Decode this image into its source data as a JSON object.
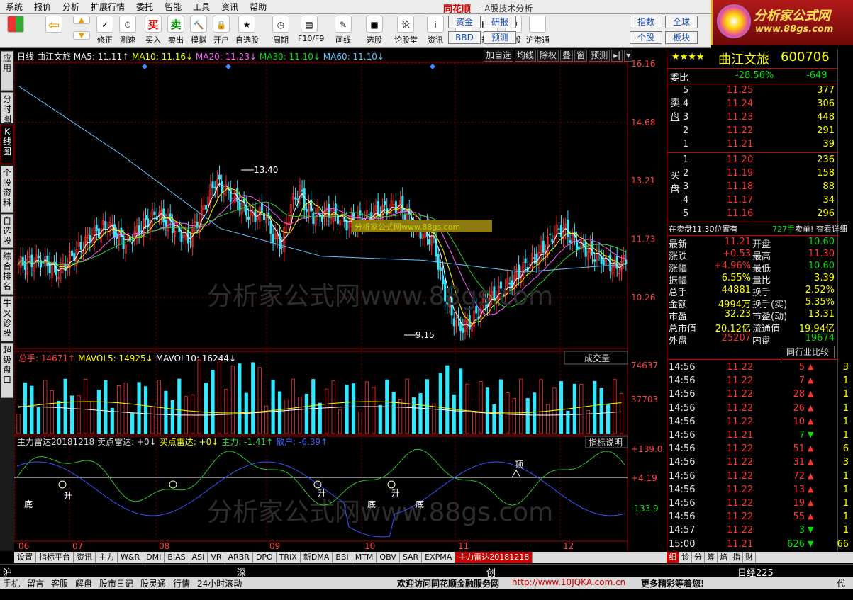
{
  "menu": {
    "items": [
      "系统",
      "报价",
      "分析",
      "扩展行情",
      "委托",
      "智能",
      "工具",
      "资讯",
      "帮助"
    ],
    "brand": "同花顺",
    "subtitle": "- A股技术分析"
  },
  "logo": {
    "title": "分析家公式网",
    "url": "www.88gs.com"
  },
  "toolbar": {
    "buttons": [
      "修正",
      "测速",
      "买入",
      "卖出",
      "模拟",
      "开户",
      "自选股",
      "周期",
      "F10/F9",
      "画线",
      "选股",
      "论股堂",
      "资讯",
      "数据",
      "热点",
      "新股",
      "沪港通"
    ],
    "button_icons": [
      "买",
      "卖"
    ],
    "small_buttons": [
      "资金",
      "研报",
      "BBD",
      "预测",
      "指数",
      "全球",
      "个股",
      "板块"
    ]
  },
  "leftbar": {
    "tabs": [
      "应用",
      "分时图",
      "K线图",
      "个股资料",
      "自选股",
      "综合排名",
      "牛叉诊股",
      "超级盘口"
    ]
  },
  "chart": {
    "period": "日线",
    "stock_name": "曲江文旅",
    "ma5": "MA5: 11.11↑",
    "ma10": "MA10: 11.16↓",
    "ma20": "MA20: 11.23↓",
    "ma30": "MA30: 11.10↓",
    "ma60": "MA60: 11.10↓",
    "buttons": [
      "加自选",
      "均线",
      "除权",
      "叠",
      "窗",
      "预测"
    ],
    "price_ticks": [
      "16.16",
      "14.68",
      "13.21",
      "11.73",
      "10.26"
    ],
    "high_label": "13.40",
    "low_label": "9.15",
    "watermark": "分析家公式网www.88gs.com",
    "ad_label": "分析家公式网www.88gs.com",
    "vol_header": {
      "total": "总手: 14671↑",
      "mavol5": "MAVOL5: 14925↓",
      "mavol10": "MAVOL10: 16244↓"
    },
    "vol_select": "成交量",
    "vol_ticks": [
      "74637",
      "37703"
    ],
    "ind_header": {
      "name": "主力雷达20181218",
      "sell": "卖点雷达: +0↓",
      "buy": "买点雷达: +0↓",
      "main": "主力: -1.41↑",
      "retail": "散户: -6.39↑"
    },
    "ind_button": "指标说明",
    "ind_ticks": [
      "+139.0",
      "+4.19",
      "-133.9"
    ],
    "ind_marks": [
      "底",
      "升",
      "升",
      "底",
      "升",
      "底",
      "顶"
    ],
    "months": [
      "06",
      "07",
      "08",
      "09",
      "10",
      "11",
      "12"
    ]
  },
  "chart_data": {
    "type": "line",
    "title": "曲江文旅 日线",
    "x": [
      "06",
      "07",
      "08",
      "09",
      "10",
      "11",
      "12"
    ],
    "series": [
      {
        "name": "MA60",
        "values": [
          15.6,
          13.9,
          12.0,
          11.3,
          11.2,
          10.9,
          11.1
        ]
      }
    ],
    "close_samples": [
      11.0,
      11.3,
      11.9,
      13.2,
      12.3,
      9.5,
      10.6,
      11.8,
      11.21
    ],
    "ylim": [
      9.15,
      16.16
    ],
    "annotations": [
      "13.40",
      "9.15"
    ]
  },
  "bottom_tabs": [
    "设置",
    "指标平台",
    "资讯",
    "主力",
    "W&R",
    "DMI",
    "BIAS",
    "ASI",
    "VR",
    "ARBR",
    "DPO",
    "TRIX",
    "新DMA",
    "BBI",
    "MTM",
    "OBV",
    "SAR",
    "EXPMA",
    "主力雷达20181218"
  ],
  "right_tabs": [
    "细",
    "诊",
    "分",
    "筹",
    "焰",
    "指",
    "财"
  ],
  "quote": {
    "stars": "★★★★",
    "name": "曲江文旅",
    "code": "600706",
    "weibi_label": "委比",
    "weibi_pct": "-28.56%",
    "weibi_val": "-649",
    "sell_label": "卖盘",
    "buy_label": "买盘",
    "sells": [
      {
        "lvl": "5",
        "price": "11.25",
        "vol": "377"
      },
      {
        "lvl": "4",
        "price": "11.24",
        "vol": "306"
      },
      {
        "lvl": "3",
        "price": "11.23",
        "vol": "448"
      },
      {
        "lvl": "2",
        "price": "11.22",
        "vol": "291"
      },
      {
        "lvl": "1",
        "price": "11.21",
        "vol": "39"
      }
    ],
    "buys": [
      {
        "lvl": "1",
        "price": "11.20",
        "vol": "236"
      },
      {
        "lvl": "2",
        "price": "11.19",
        "vol": "158"
      },
      {
        "lvl": "3",
        "price": "11.18",
        "vol": "88"
      },
      {
        "lvl": "4",
        "price": "11.17",
        "vol": "34"
      },
      {
        "lvl": "5",
        "price": "11.16",
        "vol": "296"
      }
    ],
    "notice_a": "在卖盘11.30位置有",
    "notice_b": "727手",
    "notice_c": "卖单! 查看详细",
    "stats": [
      {
        "k1": "最新",
        "v1": "11.21",
        "k2": "开盘",
        "v2": "10.60"
      },
      {
        "k1": "涨跌",
        "v1": "+0.53",
        "k2": "最高",
        "v2": "11.30"
      },
      {
        "k1": "涨幅",
        "v1": "+4.96%",
        "k2": "最低",
        "v2": "10.60"
      },
      {
        "k1": "振幅",
        "v1": "6.55%",
        "k2": "量比",
        "v2": "3.39"
      },
      {
        "k1": "总手",
        "v1": "44881",
        "k2": "换手",
        "v2": "2.52%"
      },
      {
        "k1": "金额",
        "v1": "4994万",
        "k2": "换手(实)",
        "v2": "5.35%"
      },
      {
        "k1": "市盈",
        "v1": "32.23",
        "k2": "市盈(动)",
        "v2": "13.31"
      },
      {
        "k1": "总市值",
        "v1": "20.12亿",
        "k2": "流通值",
        "v2": "19.94亿"
      },
      {
        "k1": "外盘",
        "v1": "25207",
        "k2": "内盘",
        "v2": "19674"
      }
    ],
    "peer_button": "同行业比较",
    "ticks": [
      {
        "t": "14:56",
        "p": "11.22",
        "v": "5",
        "d": "up"
      },
      {
        "t": "14:56",
        "p": "11.22",
        "v": "7",
        "d": "up"
      },
      {
        "t": "14:56",
        "p": "11.22",
        "v": "28",
        "d": "up"
      },
      {
        "t": "14:56",
        "p": "11.22",
        "v": "26",
        "d": "up"
      },
      {
        "t": "14:56",
        "p": "11.22",
        "v": "10",
        "d": "up"
      },
      {
        "t": "14:56",
        "p": "11.21",
        "v": "7",
        "d": "down"
      },
      {
        "t": "14:56",
        "p": "11.22",
        "v": "51",
        "d": "up"
      },
      {
        "t": "14:56",
        "p": "11.22",
        "v": "31",
        "d": "up"
      },
      {
        "t": "14:56",
        "p": "11.22",
        "v": "72",
        "d": "up"
      },
      {
        "t": "14:56",
        "p": "11.22",
        "v": "13",
        "d": "up"
      },
      {
        "t": "14:56",
        "p": "11.22",
        "v": "19",
        "d": "up"
      },
      {
        "t": "14:56",
        "p": "11.22",
        "v": "55",
        "d": "up"
      },
      {
        "t": "14:57",
        "p": "11.22",
        "v": "3",
        "d": "down"
      },
      {
        "t": "15:00",
        "p": "11.21",
        "v": "626",
        "d": "down"
      }
    ],
    "tick_side": [
      "3",
      "1",
      "1",
      "1",
      "1",
      "1",
      "6",
      "3",
      "1",
      "1",
      "1",
      "1",
      "1",
      "66"
    ]
  },
  "index_bar": {
    "sh": "沪",
    "sz": "深",
    "cy": "创",
    "nk": "日经225"
  },
  "status": {
    "items": [
      "手机",
      "留言",
      "客服",
      "解盘",
      "股市日记",
      "股灵通",
      "行情",
      "24小时滚动"
    ],
    "welcome": "欢迎访问同花顺金融服务网",
    "url": "http://www.10JQKA.com.cn",
    "more": "更多精彩等着您!",
    "right": "代"
  }
}
